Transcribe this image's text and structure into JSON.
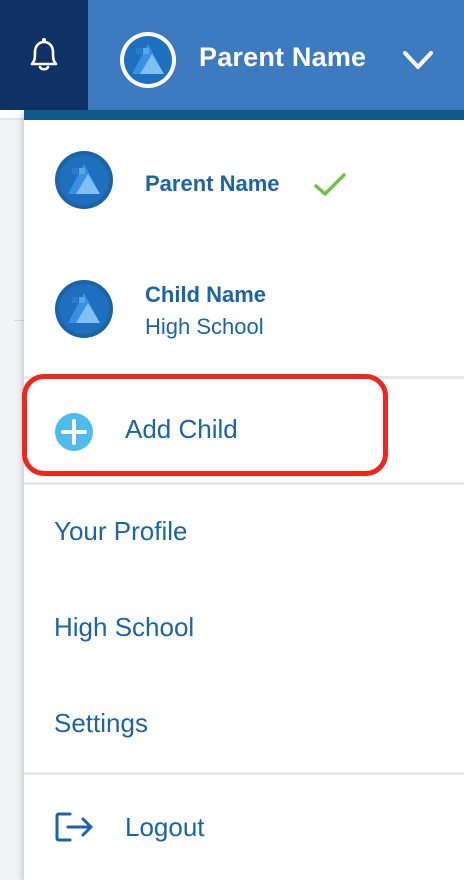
{
  "header": {
    "bell_icon": "bell-icon",
    "account_name": "Parent Name",
    "chevron_icon": "chevron-down-icon",
    "colors": {
      "bar": "#3e7ac0",
      "bell_bg": "#0f3166"
    }
  },
  "dropdown": {
    "accounts": [
      {
        "name": "Parent Name",
        "subtitle": "",
        "selected": true,
        "check_icon": "checkmark-icon"
      },
      {
        "name": "Child Name",
        "subtitle": "High School",
        "selected": false
      }
    ],
    "add_child": {
      "label": "Add Child",
      "icon": "plus-circle-icon"
    },
    "menu": [
      {
        "label": "Your Profile"
      },
      {
        "label": "High School"
      },
      {
        "label": "Settings"
      }
    ],
    "logout": {
      "label": "Logout",
      "icon": "logout-icon"
    },
    "colors": {
      "text": "#1a64a8",
      "check": "#6cc24a",
      "add_icon": "#4fbbeb",
      "highlight_outline": "#f0261b"
    }
  }
}
